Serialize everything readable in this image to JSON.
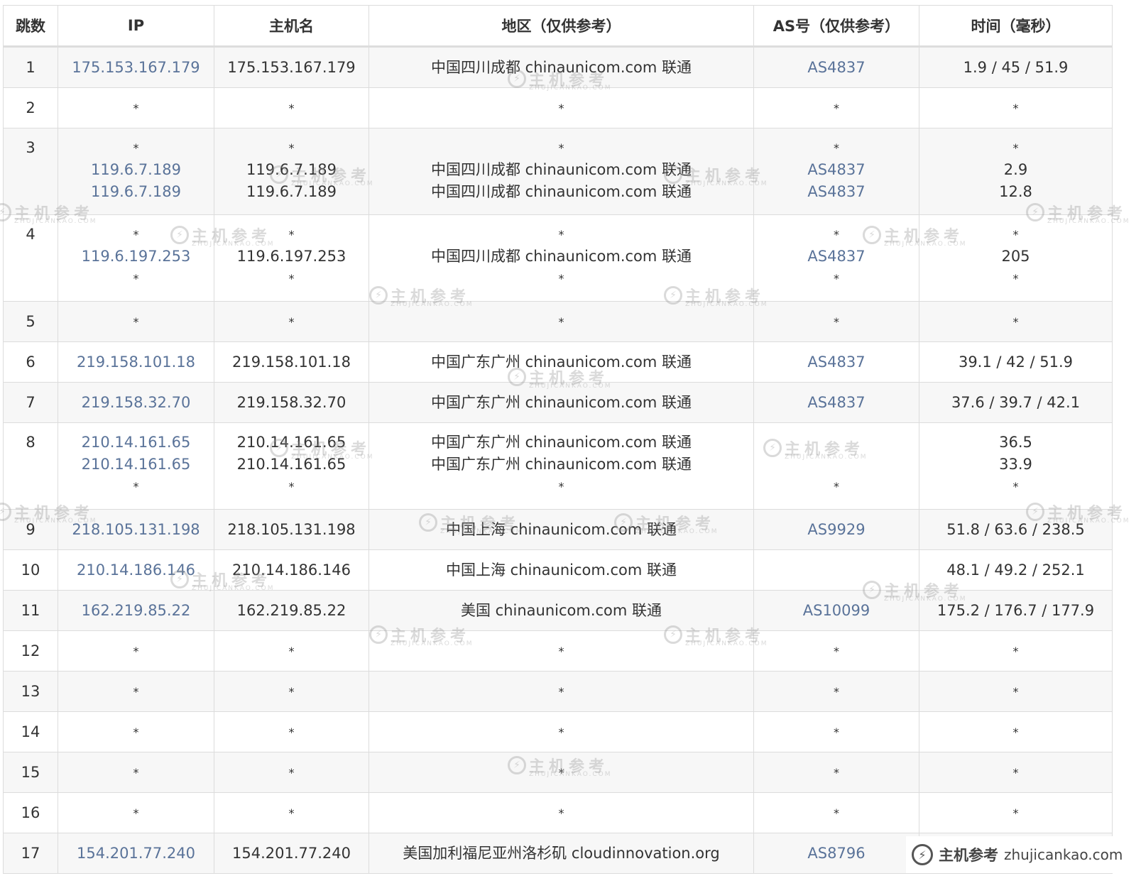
{
  "colors": {
    "link": "#5a7399",
    "text": "#333333",
    "row_alt": "#f7f7f7",
    "border": "#dcdcdc"
  },
  "table": {
    "headers": [
      "跳数",
      "IP",
      "主机名",
      "地区（仅供参考）",
      "AS号（仅供参考）",
      "时间（毫秒）"
    ],
    "rows": [
      {
        "hop": "1",
        "ip": [
          "175.153.167.179"
        ],
        "host": [
          "175.153.167.179"
        ],
        "region": [
          "中国四川成都 chinaunicom.com 联通"
        ],
        "as": [
          "AS4837"
        ],
        "time": [
          "1.9 / 45 / 51.9"
        ]
      },
      {
        "hop": "2",
        "ip": [
          "*"
        ],
        "host": [
          "*"
        ],
        "region": [
          "*"
        ],
        "as": [
          "*"
        ],
        "time": [
          "*"
        ]
      },
      {
        "hop": "3",
        "ip": [
          "*",
          "119.6.7.189",
          "119.6.7.189"
        ],
        "host": [
          "*",
          "119.6.7.189",
          "119.6.7.189"
        ],
        "region": [
          "*",
          "中国四川成都 chinaunicom.com 联通",
          "中国四川成都 chinaunicom.com 联通"
        ],
        "as": [
          "*",
          "AS4837",
          "AS4837"
        ],
        "time": [
          "*",
          "2.9",
          "12.8"
        ]
      },
      {
        "hop": "4",
        "ip": [
          "*",
          "119.6.197.253",
          "*"
        ],
        "host": [
          "*",
          "119.6.197.253",
          "*"
        ],
        "region": [
          "*",
          "中国四川成都 chinaunicom.com 联通",
          "*"
        ],
        "as": [
          "*",
          "AS4837",
          "*"
        ],
        "time": [
          "*",
          "205",
          "*"
        ]
      },
      {
        "hop": "5",
        "ip": [
          "*"
        ],
        "host": [
          "*"
        ],
        "region": [
          "*"
        ],
        "as": [
          "*"
        ],
        "time": [
          "*"
        ]
      },
      {
        "hop": "6",
        "ip": [
          "219.158.101.18"
        ],
        "host": [
          "219.158.101.18"
        ],
        "region": [
          "中国广东广州 chinaunicom.com 联通"
        ],
        "as": [
          "AS4837"
        ],
        "time": [
          "39.1 / 42 / 51.9"
        ]
      },
      {
        "hop": "7",
        "ip": [
          "219.158.32.70"
        ],
        "host": [
          "219.158.32.70"
        ],
        "region": [
          "中国广东广州 chinaunicom.com 联通"
        ],
        "as": [
          "AS4837"
        ],
        "time": [
          "37.6 / 39.7 / 42.1"
        ]
      },
      {
        "hop": "8",
        "ip": [
          "210.14.161.65",
          "210.14.161.65",
          "*"
        ],
        "host": [
          "210.14.161.65",
          "210.14.161.65",
          "*"
        ],
        "region": [
          "中国广东广州 chinaunicom.com 联通",
          "中国广东广州 chinaunicom.com 联通",
          "*"
        ],
        "as": [
          "",
          "",
          "*"
        ],
        "time": [
          "36.5",
          "33.9",
          "*"
        ]
      },
      {
        "hop": "9",
        "ip": [
          "218.105.131.198"
        ],
        "host": [
          "218.105.131.198"
        ],
        "region": [
          "中国上海 chinaunicom.com 联通"
        ],
        "as": [
          "AS9929"
        ],
        "time": [
          "51.8 / 63.6 / 238.5"
        ]
      },
      {
        "hop": "10",
        "ip": [
          "210.14.186.146"
        ],
        "host": [
          "210.14.186.146"
        ],
        "region": [
          "中国上海 chinaunicom.com 联通"
        ],
        "as": [
          ""
        ],
        "time": [
          "48.1 / 49.2 / 252.1"
        ]
      },
      {
        "hop": "11",
        "ip": [
          "162.219.85.22"
        ],
        "host": [
          "162.219.85.22"
        ],
        "region": [
          "美国 chinaunicom.com 联通"
        ],
        "as": [
          "AS10099"
        ],
        "time": [
          "175.2 / 176.7 / 177.9"
        ]
      },
      {
        "hop": "12",
        "ip": [
          "*"
        ],
        "host": [
          "*"
        ],
        "region": [
          "*"
        ],
        "as": [
          "*"
        ],
        "time": [
          "*"
        ]
      },
      {
        "hop": "13",
        "ip": [
          "*"
        ],
        "host": [
          "*"
        ],
        "region": [
          "*"
        ],
        "as": [
          "*"
        ],
        "time": [
          "*"
        ]
      },
      {
        "hop": "14",
        "ip": [
          "*"
        ],
        "host": [
          "*"
        ],
        "region": [
          "*"
        ],
        "as": [
          "*"
        ],
        "time": [
          "*"
        ]
      },
      {
        "hop": "15",
        "ip": [
          "*"
        ],
        "host": [
          "*"
        ],
        "region": [
          "*"
        ],
        "as": [
          "*"
        ],
        "time": [
          "*"
        ]
      },
      {
        "hop": "16",
        "ip": [
          "*"
        ],
        "host": [
          "*"
        ],
        "region": [
          "*"
        ],
        "as": [
          "*"
        ],
        "time": [
          "*"
        ]
      },
      {
        "hop": "17",
        "ip": [
          "154.201.77.240"
        ],
        "host": [
          "154.201.77.240"
        ],
        "region": [
          "美国加利福尼亚州洛杉矶 cloudinnovation.org"
        ],
        "as": [
          "AS8796"
        ],
        "time": [
          ""
        ]
      }
    ]
  },
  "watermark": {
    "cn": "主机参考",
    "en": "ZHUJICANKAO.COM",
    "icon": "lightning-circle-icon"
  },
  "brand": {
    "icon": "lightning-circle-icon",
    "cn": "主机参考",
    "url": "zhujicankao.com",
    "glyph": "⚡"
  }
}
